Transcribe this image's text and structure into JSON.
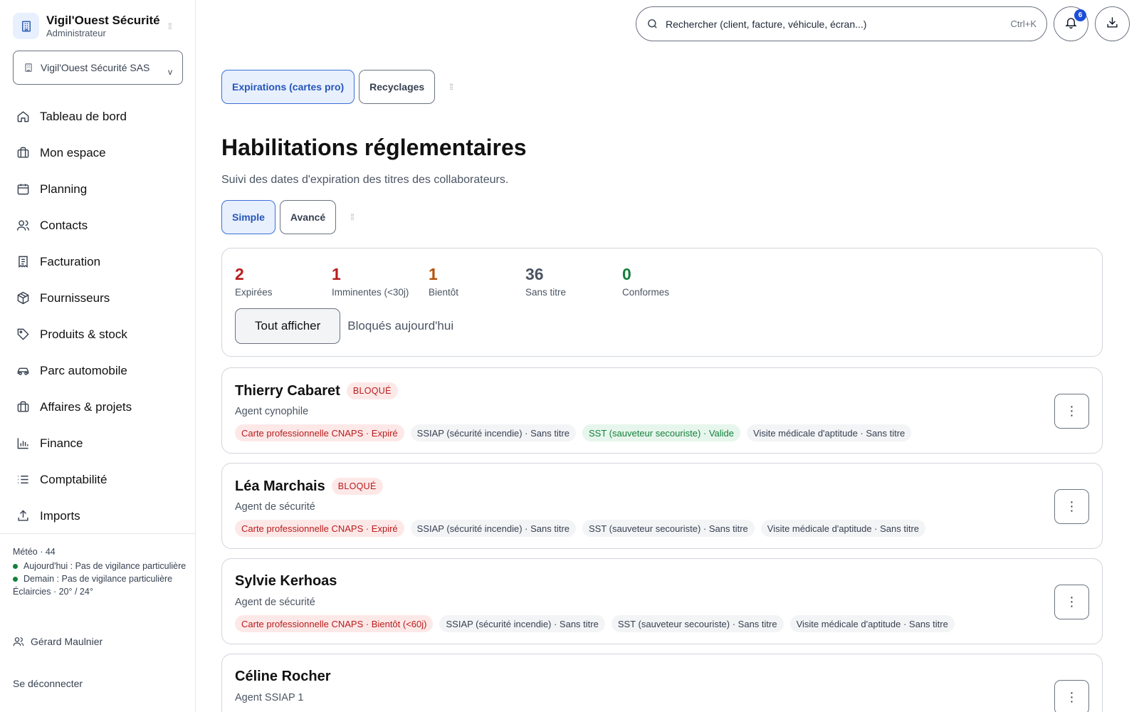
{
  "brand": {
    "name": "Vigil'Ouest Sécurité",
    "role": "Administrateur"
  },
  "company_select": {
    "value": "Vigil'Ouest Sécurité SAS",
    "chevron": "v"
  },
  "nav": [
    {
      "label": "Tableau de bord",
      "icon": "home-icon"
    },
    {
      "label": "Mon espace",
      "icon": "briefcase-icon"
    },
    {
      "label": "Planning",
      "icon": "calendar-icon"
    },
    {
      "label": "Contacts",
      "icon": "users-icon"
    },
    {
      "label": "Facturation",
      "icon": "receipt-icon"
    },
    {
      "label": "Fournisseurs",
      "icon": "box-icon"
    },
    {
      "label": "Produits & stock",
      "icon": "tag-icon"
    },
    {
      "label": "Parc automobile",
      "icon": "car-icon"
    },
    {
      "label": "Affaires & projets",
      "icon": "briefcase-icon"
    },
    {
      "label": "Finance",
      "icon": "bar-chart-icon"
    },
    {
      "label": "Comptabilité",
      "icon": "list-icon"
    },
    {
      "label": "Imports",
      "icon": "upload-icon"
    }
  ],
  "weather": {
    "title": "Météo · 44",
    "today": "Aujourd'hui : Pas de vigilance particulière",
    "tomorrow": "Demain : Pas de vigilance particulière",
    "sky": "Éclaircies · 20° / 24°"
  },
  "user": {
    "name": "Gérard Maulnier"
  },
  "logout_label": "Se déconnecter",
  "search": {
    "placeholder": "Rechercher (client, facture, véhicule, écran...)",
    "shortcut": "Ctrl+K"
  },
  "notifications": {
    "count": "6"
  },
  "tabs_top": [
    {
      "label": "Expirations (cartes pro)",
      "active": true
    },
    {
      "label": "Recyclages",
      "active": false
    }
  ],
  "page": {
    "title": "Habilitations réglementaires",
    "subtitle": "Suivi des dates d'expiration des titres des collaborateurs."
  },
  "tabs_mode": [
    {
      "label": "Simple",
      "active": true
    },
    {
      "label": "Avancé",
      "active": false
    }
  ],
  "stats": [
    {
      "value": "2",
      "label": "Expirées",
      "color": "#b91c1c"
    },
    {
      "value": "1",
      "label": "Imminentes (<30j)",
      "color": "#b91c1c"
    },
    {
      "value": "1",
      "label": "Bientôt",
      "color": "#b45309"
    },
    {
      "value": "36",
      "label": "Sans titre",
      "color": "#4b5563"
    },
    {
      "value": "0",
      "label": "Conformes",
      "color": "#15803d"
    }
  ],
  "filters": {
    "show_all": "Tout afficher",
    "blocked_today": "Bloqués aujourd'hui"
  },
  "people": [
    {
      "name": "Thierry Cabaret",
      "badge": "BLOQUÉ",
      "role": "Agent cynophile",
      "tags": [
        {
          "text": "Carte professionnelle CNAPS · Expiré",
          "status": "expired"
        },
        {
          "text": "SSIAP (sécurité incendie) · Sans titre",
          "status": "none"
        },
        {
          "text": "SST (sauveteur secouriste) · Valide",
          "status": "valid"
        },
        {
          "text": "Visite médicale d'aptitude · Sans titre",
          "status": "none"
        }
      ]
    },
    {
      "name": "Léa Marchais",
      "badge": "BLOQUÉ",
      "role": "Agent de sécurité",
      "tags": [
        {
          "text": "Carte professionnelle CNAPS · Expiré",
          "status": "expired"
        },
        {
          "text": "SSIAP (sécurité incendie) · Sans titre",
          "status": "none"
        },
        {
          "text": "SST (sauveteur secouriste) · Sans titre",
          "status": "none"
        },
        {
          "text": "Visite médicale d'aptitude · Sans titre",
          "status": "none"
        }
      ]
    },
    {
      "name": "Sylvie Kerhoas",
      "badge": "",
      "role": "Agent de sécurité",
      "tags": [
        {
          "text": "Carte professionnelle CNAPS · Bientôt (<60j)",
          "status": "expired"
        },
        {
          "text": "SSIAP (sécurité incendie) · Sans titre",
          "status": "none"
        },
        {
          "text": "SST (sauveteur secouriste) · Sans titre",
          "status": "none"
        },
        {
          "text": "Visite médicale d'aptitude · Sans titre",
          "status": "none"
        }
      ]
    },
    {
      "name": "Céline Rocher",
      "badge": "",
      "role": "Agent SSIAP 1",
      "tags": []
    }
  ],
  "kebab_label": "⋮"
}
